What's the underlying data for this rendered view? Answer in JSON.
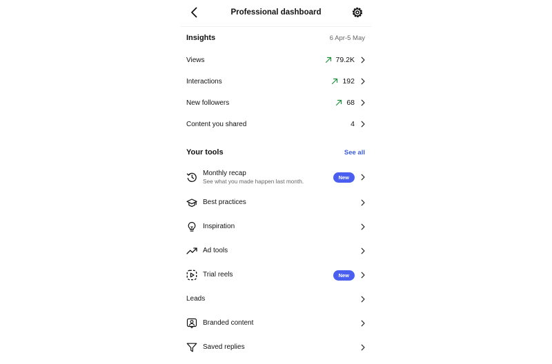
{
  "header": {
    "title": "Professional dashboard"
  },
  "insights": {
    "title": "Insights",
    "date_range": "6 Apr-5 May",
    "rows": [
      {
        "label": "Views",
        "value": "79.2K",
        "trend": "up"
      },
      {
        "label": "Interactions",
        "value": "192",
        "trend": "up"
      },
      {
        "label": "New followers",
        "value": "68",
        "trend": "up"
      },
      {
        "label": "Content you shared",
        "value": "4",
        "trend": "none"
      }
    ]
  },
  "tools": {
    "title": "Your tools",
    "see_all": "See all",
    "items": [
      {
        "label": "Monthly recap",
        "subtitle": "See what you made happen last month.",
        "badge": "New",
        "icon": "history-icon"
      },
      {
        "label": "Best practices",
        "icon": "graduation-cap-icon"
      },
      {
        "label": "Inspiration",
        "icon": "lightbulb-icon"
      },
      {
        "label": "Ad tools",
        "icon": "trending-up-icon"
      },
      {
        "label": "Trial reels",
        "badge": "New",
        "icon": "trial-reels-icon"
      },
      {
        "label": "Leads",
        "icon": ""
      },
      {
        "label": "Branded content",
        "icon": "branded-content-icon"
      },
      {
        "label": "Saved replies",
        "icon": "saved-replies-icon"
      }
    ]
  },
  "colors": {
    "accent": "#3b5bdb",
    "badge": "#4a5ef0",
    "trend_up": "#1e8e3e"
  }
}
